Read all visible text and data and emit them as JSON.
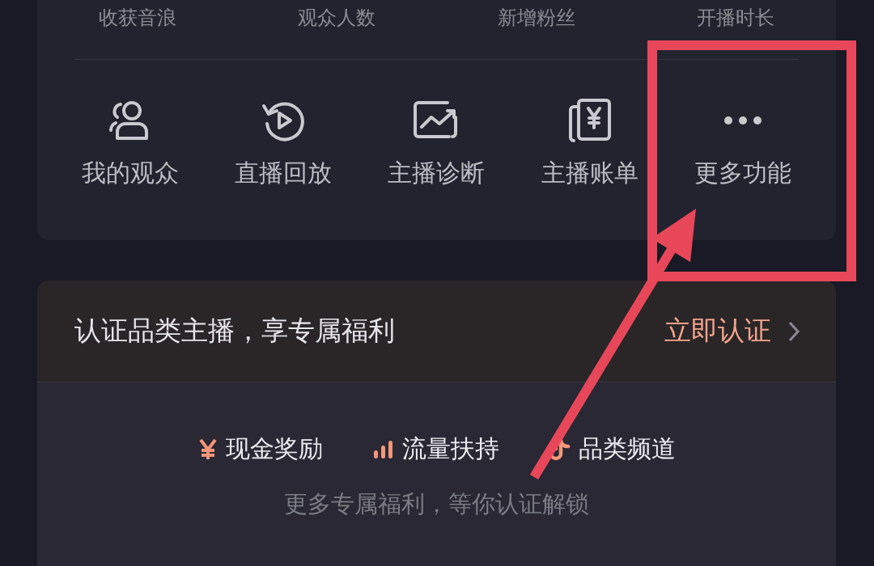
{
  "stats": {
    "labels": [
      "收获音浪",
      "观众人数",
      "新增粉丝",
      "开播时长"
    ]
  },
  "tools": [
    {
      "label": "我的观众"
    },
    {
      "label": "直播回放"
    },
    {
      "label": "主播诊断"
    },
    {
      "label": "主播账单"
    },
    {
      "label": "更多功能"
    }
  ],
  "certification": {
    "title": "认证品类主播，享专属福利",
    "action": "立即认证",
    "benefits": [
      {
        "label": "现金奖励"
      },
      {
        "label": "流量扶持"
      },
      {
        "label": "品类频道"
      }
    ],
    "note": "更多专属福利，等你认证解锁"
  }
}
